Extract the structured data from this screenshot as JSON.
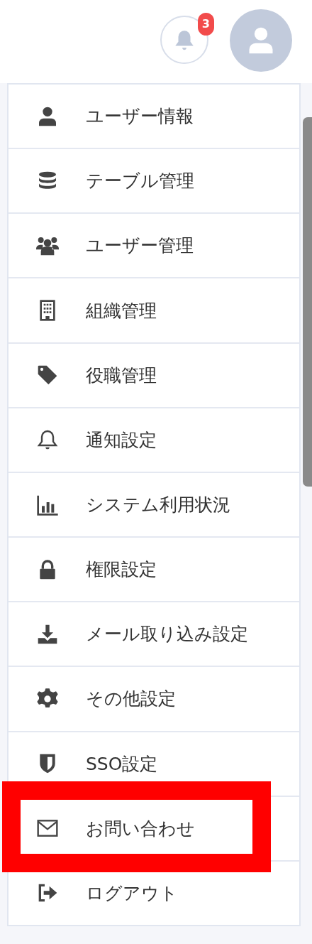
{
  "header": {
    "notifications": {
      "count": "3"
    }
  },
  "menu": {
    "items": [
      {
        "label": "ユーザー情報",
        "highlighted": false
      },
      {
        "label": "テーブル管理",
        "highlighted": false
      },
      {
        "label": "ユーザー管理",
        "highlighted": false
      },
      {
        "label": "組織管理",
        "highlighted": false
      },
      {
        "label": "役職管理",
        "highlighted": false
      },
      {
        "label": "通知設定",
        "highlighted": false
      },
      {
        "label": "システム利用状況",
        "highlighted": false
      },
      {
        "label": "権限設定",
        "highlighted": false
      },
      {
        "label": "メール取り込み設定",
        "highlighted": false
      },
      {
        "label": "その他設定",
        "highlighted": false
      },
      {
        "label": "SSO設定",
        "highlighted": false
      },
      {
        "label": "お問い合わせ",
        "highlighted": true
      },
      {
        "label": "ログアウト",
        "highlighted": false
      }
    ]
  }
}
